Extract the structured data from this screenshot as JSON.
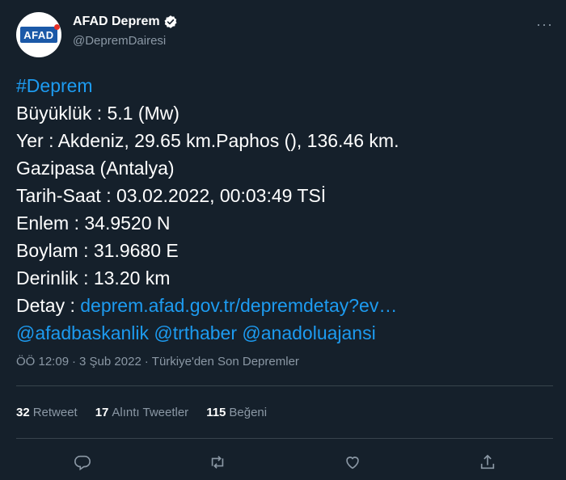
{
  "author": {
    "display_name": "AFAD Deprem",
    "handle": "@DepremDairesi",
    "avatar_logo": "AFAD"
  },
  "tweet": {
    "hashtag": "#Deprem",
    "magnitude_line": "Büyüklük : 5.1 (Mw)",
    "location_line1": "Yer : Akdeniz, 29.65 km.Paphos (), 136.46 km.",
    "location_line2": "Gazipasa (Antalya)",
    "datetime_line": "Tarih-Saat : 03.02.2022, 00:03:49 TSİ",
    "latitude_line": "Enlem : 34.9520 N",
    "longitude_line": "Boylam : 31.9680 E",
    "depth_line": "Derinlik : 13.20 km",
    "detail_prefix": "Detay : ",
    "detail_link": "deprem.afad.gov.tr/depremdetay?ev…",
    "mentions": [
      "@afadbaskanlik",
      "@trthaber",
      "@anadoluajansi"
    ]
  },
  "meta": {
    "time": "ÖÖ 12:09",
    "date": "3 Şub 2022",
    "source": "Türkiye'den Son Depremler",
    "separator": "·"
  },
  "stats": {
    "retweets": {
      "count": "32",
      "label": "Retweet"
    },
    "quotes": {
      "count": "17",
      "label": "Alıntı Tweetler"
    },
    "likes": {
      "count": "115",
      "label": "Beğeni"
    }
  },
  "icons": {
    "more": "more-icon",
    "verified": "verified-icon",
    "reply": "reply-icon",
    "retweet": "retweet-icon",
    "like": "like-icon",
    "share": "share-icon"
  },
  "colors": {
    "background": "#15202b",
    "link": "#1d9bf0",
    "secondary_text": "#8b98a5",
    "divider": "#38444d"
  }
}
